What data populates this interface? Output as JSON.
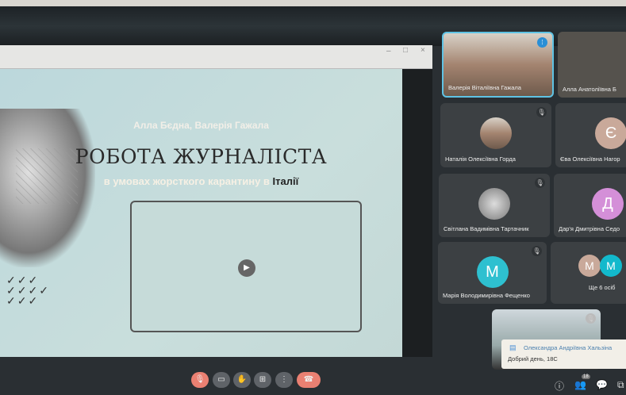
{
  "window": {
    "minimize": "–",
    "maximize": "□",
    "close": "×"
  },
  "slide": {
    "authors": "Алла Бєдна, Валерія Гажала",
    "title": "РОБОТА ЖУРНАЛІСТА",
    "subtitle": "в умовах жорсткого карантину в",
    "subtitle_highlight": "Італії",
    "play": "▶"
  },
  "participants": [
    {
      "name": "Валерія Віталіївна Гажала",
      "active": true
    },
    {
      "name": "Алла Анатоліївна Б"
    },
    {
      "name": "Наталія Олексіївна Горда",
      "muted": true
    },
    {
      "name": "Єва Олексіївна Нагор",
      "initial": "Є",
      "color": "#c9a99a"
    },
    {
      "name": "Світлана Вадимівна Тартачник",
      "muted": true
    },
    {
      "name": "Дар'я Дмитрівна Седо",
      "initial": "Д",
      "color": "#d48fd8"
    },
    {
      "name": "Марія Володимирівна Фещенко",
      "initial": "М",
      "color": "#2ec0d0",
      "muted": true
    },
    {
      "more": "Ще 6 осіб",
      "initials": [
        "М",
        "М"
      ],
      "colors": [
        "#c9a99a",
        "#12b9cc"
      ]
    }
  ],
  "chat": {
    "sender": "Олександра Андріївна Хальзіна",
    "message": "Добрий день, 18С"
  },
  "controls": {
    "mic": "🎙",
    "camera": "▭",
    "hand": "✋",
    "present": "⊞",
    "more": "⋮",
    "end": "☎"
  },
  "bottom": {
    "info": "ⓘ",
    "people": "👥",
    "people_count": "18",
    "chat": "💬",
    "activities": "⧉"
  },
  "colors": {
    "accent": "#5fc3e4",
    "end_call": "#ea8072"
  }
}
